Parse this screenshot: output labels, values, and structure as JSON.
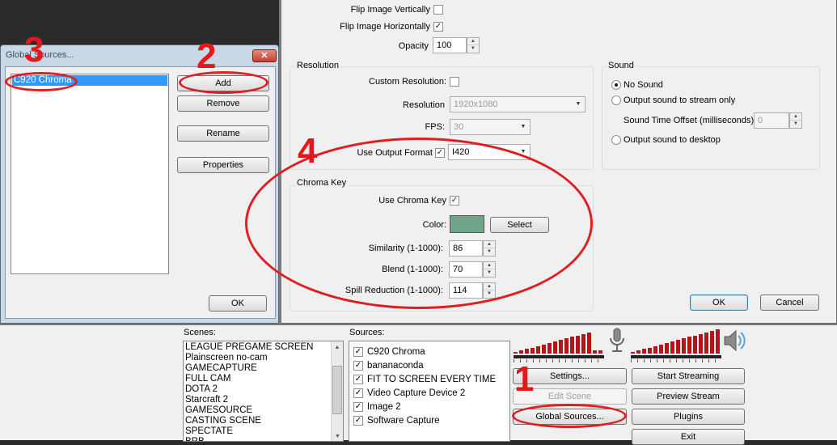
{
  "props": {
    "flip_v_label": "Flip Image Vertically",
    "flip_h_label": "Flip Image Horizontally",
    "opacity_label": "Opacity",
    "opacity_value": "100",
    "resolution_group": "Resolution",
    "custom_res_label": "Custom Resolution:",
    "resolution_label": "Resolution",
    "resolution_value": "1920x1080",
    "fps_label": "FPS:",
    "fps_value": "30",
    "output_format_label": "Use Output Format",
    "output_format_value": "I420",
    "sound_group": "Sound",
    "no_sound": "No Sound",
    "stream_only": "Output sound to stream only",
    "time_offset_label": "Sound Time Offset (milliseconds)",
    "time_offset_value": "0",
    "desktop": "Output sound to desktop",
    "chroma_group": "Chroma Key",
    "use_chroma_label": "Use Chroma Key",
    "color_label": "Color:",
    "color_value": "#6fa589",
    "select_label": "Select",
    "similarity_label": "Similarity (1-1000):",
    "similarity_value": "86",
    "blend_label": "Blend (1-1000):",
    "blend_value": "70",
    "spill_label": "Spill Reduction (1-1000):",
    "spill_value": "114",
    "ok_label": "OK",
    "cancel_label": "Cancel"
  },
  "global_sources": {
    "title": "Global Sources...",
    "items": [
      "C920 Chroma"
    ],
    "add": "Add",
    "remove": "Remove",
    "rename": "Rename",
    "properties": "Properties",
    "ok": "OK"
  },
  "main": {
    "scenes_label": "Scenes:",
    "scenes": [
      "LEAGUE PREGAME SCREEN",
      "Plainscreen no-cam",
      "GAMECAPTURE",
      "FULL CAM",
      "DOTA 2",
      "Starcraft 2",
      "GAMESOURCE",
      "CASTING SCENE",
      "SPECTATE",
      "BRB"
    ],
    "sources_label": "Sources:",
    "sources": [
      "C920 Chroma",
      "bananaconda",
      "FIT TO SCREEN EVERY TIME",
      "Video Capture Device 2",
      "Image 2",
      "Software Capture"
    ],
    "settings": "Settings...",
    "edit_scene": "Edit Scene",
    "global_sources": "Global Sources...",
    "start_streaming": "Start Streaming",
    "preview_stream": "Preview Stream",
    "plugins": "Plugins",
    "exit": "Exit",
    "mic_icon": "microphone-icon",
    "speaker_icon": "speaker-icon",
    "mic_level": 0.9,
    "desktop_level": 1.0
  },
  "annotations": {
    "n1": "1",
    "n2": "2",
    "n3": "3",
    "n4": "4"
  }
}
